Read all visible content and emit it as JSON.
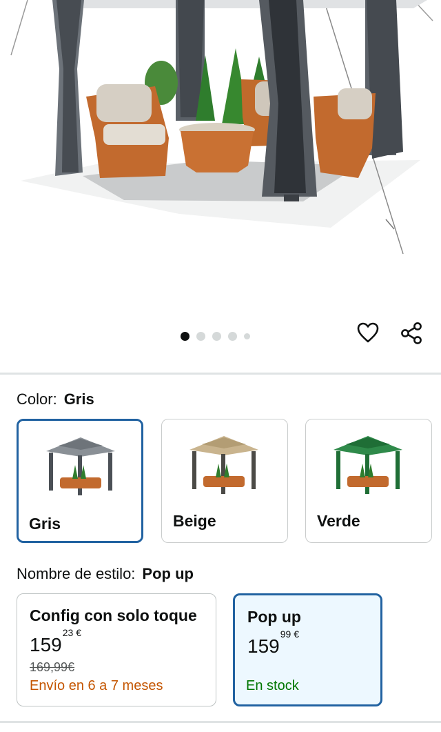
{
  "carousel": {
    "total": 5,
    "active": 0
  },
  "actions": {
    "favorite_icon": "heart-outline-icon",
    "share_icon": "share-icon"
  },
  "color": {
    "label": "Color:",
    "selected_value": "Gris",
    "options": [
      {
        "name": "Gris",
        "roof_color": "#8a9096",
        "selected": true
      },
      {
        "name": "Beige",
        "roof_color": "#c9b48e",
        "selected": false
      },
      {
        "name": "Verde",
        "roof_color": "#2f8a4a",
        "selected": false
      }
    ]
  },
  "style": {
    "label": "Nombre de estilo:",
    "selected_value": "Pop up",
    "options": [
      {
        "name": "Config con solo toque",
        "price_whole": "159",
        "price_fraction": "23",
        "currency": "€",
        "list_price": "169,99€",
        "availability": "Envío en 6 a 7 meses",
        "selected": false
      },
      {
        "name": "Pop up",
        "price_whole": "159",
        "price_fraction": "99",
        "currency": "€",
        "availability": "En stock",
        "selected": true
      }
    ]
  },
  "colors": {
    "accent_blue": "#2162a1",
    "selected_bg": "#edf8ff",
    "shipping_orange": "#c45500",
    "stock_green": "#007600"
  }
}
